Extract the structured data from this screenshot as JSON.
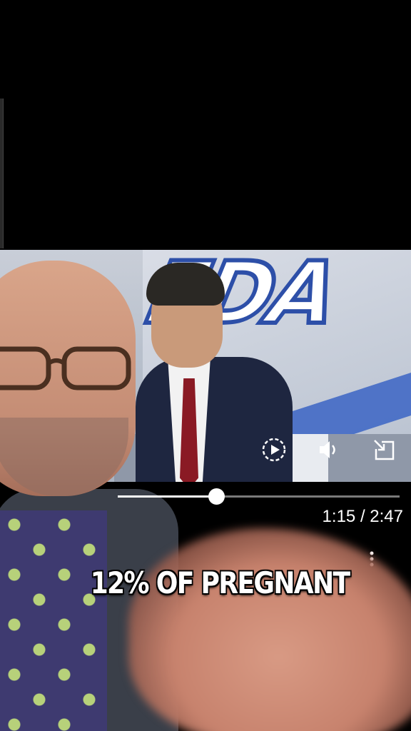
{
  "player": {
    "current_time": "1:15",
    "separator": "/",
    "duration": "2:47",
    "progress_fraction": 0.35
  },
  "overlay": {
    "video_logo_text": "FDA",
    "caption": "12% OF PREGNANT"
  },
  "icons": {
    "replay": "replay-icon",
    "volume": "volume-icon",
    "pip": "picture-in-picture-icon",
    "more": "more-vertical-icon"
  },
  "colors": {
    "background": "#000000",
    "caption": "#ffffff",
    "progress_fill": "#ffffff",
    "progress_track": "#7a7a7a",
    "fda_blue": "#2d4fa8"
  }
}
